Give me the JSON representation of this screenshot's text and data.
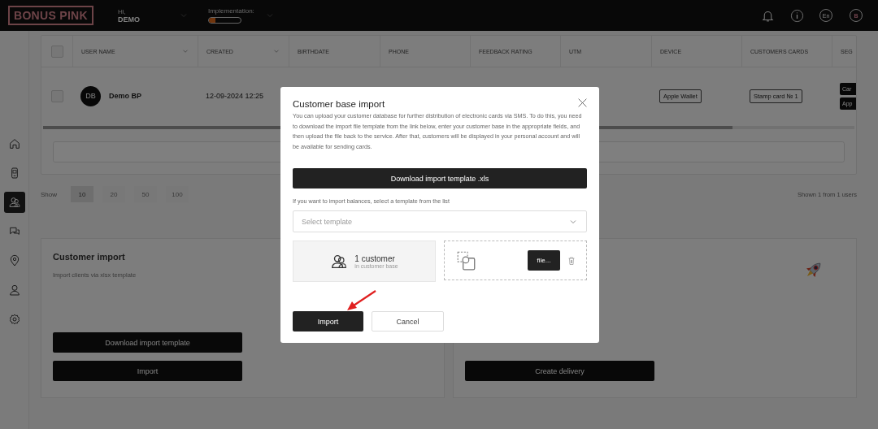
{
  "header": {
    "logo": "BONUS PINK",
    "greeting": "Hi,",
    "user": "DEMO",
    "implementation_label": "Implementation:",
    "implementation": {
      "level": 0.2
    },
    "language": "En",
    "account_initial": "B"
  },
  "sidebar": {
    "items": [
      {
        "kind": "home",
        "selected": false
      },
      {
        "kind": "phone",
        "selected": false
      },
      {
        "kind": "customers",
        "selected": true
      },
      {
        "kind": "chat",
        "selected": false
      },
      {
        "kind": "location",
        "selected": false
      },
      {
        "kind": "user",
        "selected": false
      },
      {
        "kind": "settings",
        "selected": false
      }
    ]
  },
  "table": {
    "header_checked": false,
    "columns": [
      "USER NAME",
      "CREATED",
      "BIRTHDATE",
      "PHONE",
      "FEEDBACK RATING",
      "UTM",
      "DEVICE",
      "CUSTOMERS CARDS",
      "SEG"
    ],
    "rows": [
      {
        "checked": false,
        "initials": "DB",
        "user_name": "Demo BP",
        "created": "12-09-2024 12:25",
        "device": "Apple Wallet",
        "customers_cards": "Stamp card № 1",
        "actions": [
          "Car",
          "App"
        ]
      }
    ]
  },
  "pagination": {
    "label": "Show",
    "sizes": [
      {
        "label": "10",
        "selected": true
      },
      {
        "label": "20",
        "selected": false
      },
      {
        "label": "50",
        "selected": false
      },
      {
        "label": "100",
        "selected": false
      }
    ],
    "summary": "Shown 1 from 1 users"
  },
  "import_card": {
    "title": "Customer import",
    "description": "Import clients via xlsx template",
    "buttons": [
      "Download import template",
      "Import"
    ]
  },
  "delivery_card": {
    "button": "Create delivery"
  },
  "modal": {
    "title": "Customer base import",
    "description": "You can upload your customer database for further distribution of electronic cards via SMS. To do this, you need to download the import file template from the link below, enter your customer base in the appropriate fields, and then upload the file back to the service. After that, customers will be displayed in your personal account and will be available for sending cards.",
    "download_button": "Download import template .xls",
    "template_hint": "If you want to import balances, select a template from the list",
    "template_select": {
      "placeholder": "Select template"
    },
    "customers": {
      "count": "1 customer",
      "caption": "in customer base"
    },
    "file_button": "file...",
    "import_button": "Import",
    "cancel_button": "Cancel"
  }
}
